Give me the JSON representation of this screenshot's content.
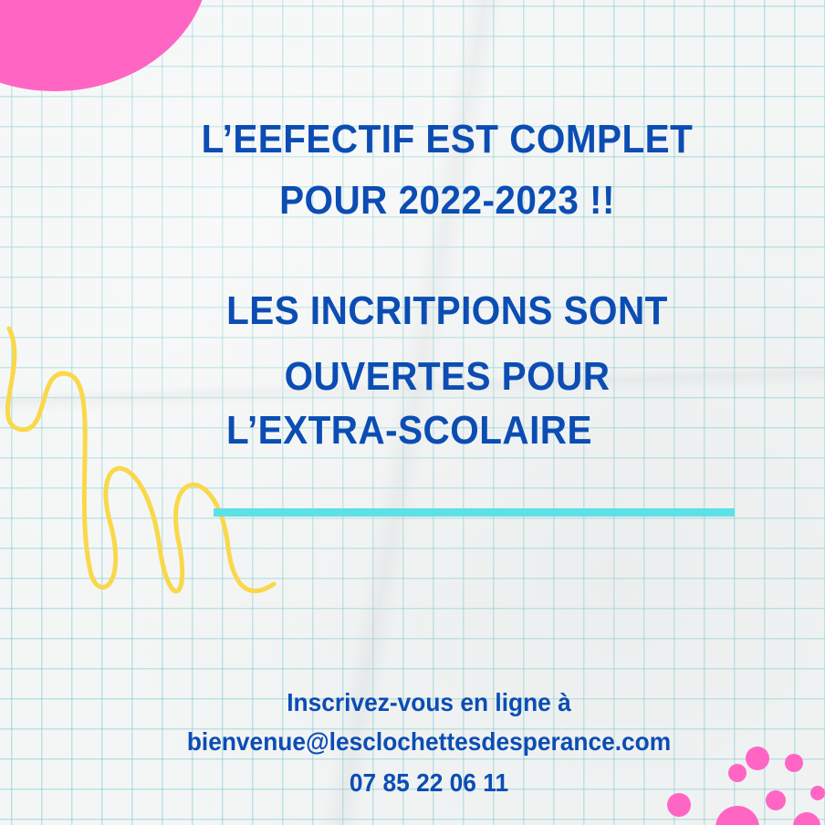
{
  "headline": {
    "line1": "L’EEFECTIF EST COMPLET",
    "line2": "POUR 2022-2023 !!",
    "line3": "LES INCRITPIONS SONT",
    "line4": "OUVERTES POUR",
    "line5": "L’EXTRA-SCOLAIRE"
  },
  "contact": {
    "intro": "Inscrivez-vous en ligne à",
    "email": "bienvenue@lesclochettesdesperance.com",
    "phone": "07 85 22 06 11"
  },
  "colors": {
    "text": "#0b4db3",
    "accent_line": "#5ce1e6",
    "pink": "#ff66c4",
    "squiggle": "#f9d84a",
    "grid": "#78c8cd"
  },
  "decorations": {
    "top_left": "pink-circle",
    "left": "yellow-squiggle",
    "bottom_right": "pink-dots"
  }
}
